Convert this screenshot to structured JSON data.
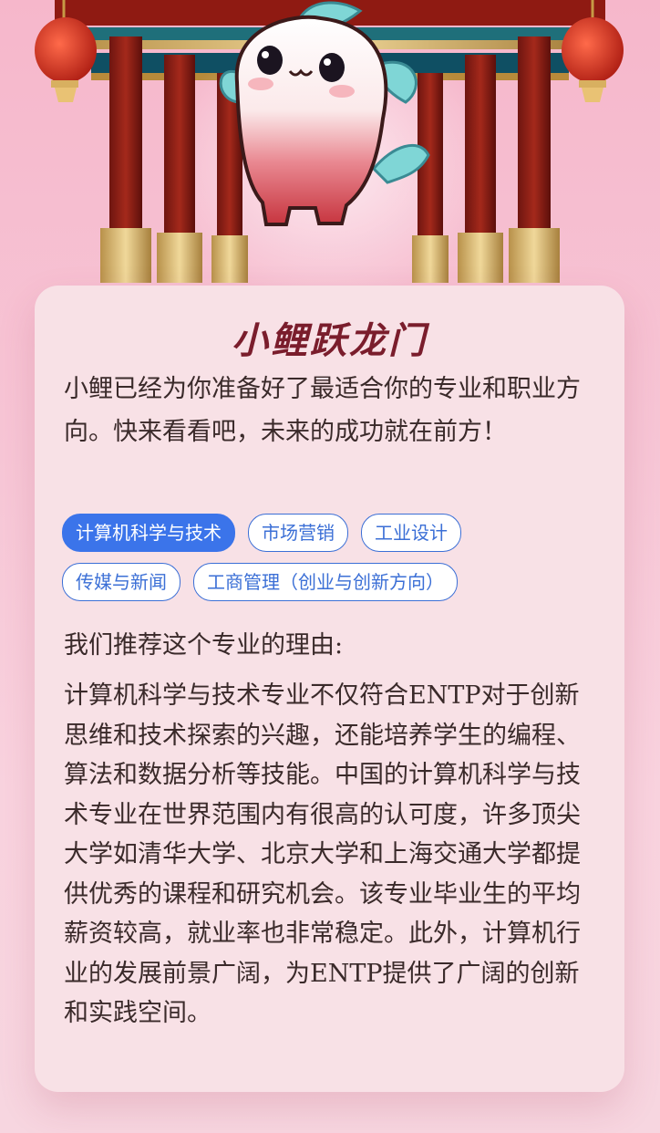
{
  "card": {
    "title": "小鲤跃龙门",
    "intro": "小鲤已经为你准备好了最适合你的专业和职业方向。快来看看吧，未来的成功就在前方！"
  },
  "majors": {
    "items": [
      {
        "label": "计算机科学与技术",
        "selected": true
      },
      {
        "label": "市场营销",
        "selected": false
      },
      {
        "label": "工业设计",
        "selected": false
      },
      {
        "label": "传媒与新闻",
        "selected": false
      },
      {
        "label": "工商管理（创业与创新方向）",
        "selected": false
      }
    ]
  },
  "recommendation": {
    "heading": "我们推荐这个专业的理由:",
    "body": "计算机科学与技术专业不仅符合ENTP对于创新思维和技术探索的兴趣，还能培养学生的编程、算法和数据分析等技能。中国的计算机科学与技术专业在世界范围内有很高的认可度，许多顶尖大学如清华大学、北京大学和上海交通大学都提供优秀的课程和研究机会。该专业毕业生的平均薪资较高，就业率也非常稳定。此外，计算机行业的发展前景广阔，为ENTP提供了广阔的创新和实践空间。"
  },
  "colors": {
    "accent": "#3b74ea",
    "title": "#7a1d2c",
    "card_bg": "#f8e1e6"
  },
  "icons": {
    "mascot": "carp-mascot-illustration",
    "lanterns": "red-lantern-icon",
    "gate": "chinese-gate-illustration"
  }
}
